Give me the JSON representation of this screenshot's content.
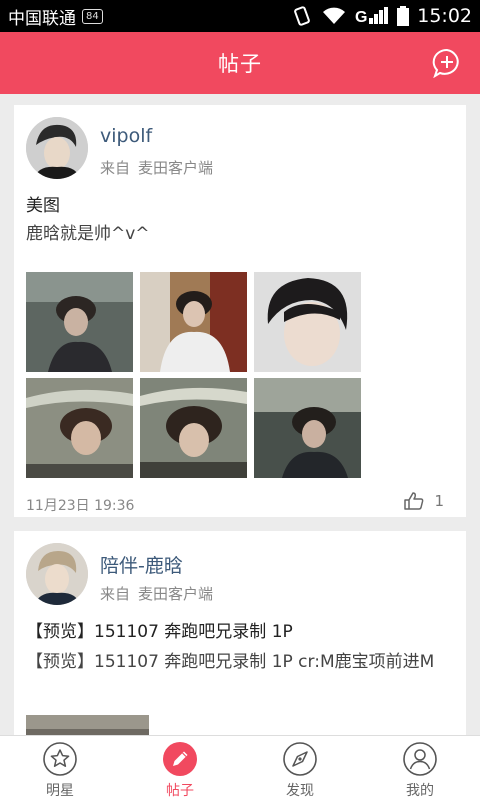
{
  "status_bar": {
    "carrier": "中国联通",
    "network_badge": "84",
    "time": "15:02"
  },
  "header": {
    "title": "帖子",
    "compose_icon": "add-comment-icon",
    "accent_color": "#f1495f"
  },
  "posts": [
    {
      "username": "vipolf",
      "source_prefix": "来自",
      "source_client": "麦田客户端",
      "title": "美图",
      "body": "鹿晗就是帅^v^",
      "image_count": 6,
      "time": "11月23日 19:36",
      "likes": "1"
    },
    {
      "username": "陪伴-鹿晗",
      "source_prefix": "来自",
      "source_client": "麦田客户端",
      "title": "【预览】151107 奔跑吧兄录制 1P",
      "body": "【预览】151107 奔跑吧兄录制 1P cr:M鹿宝项前进M"
    }
  ],
  "tabs": [
    {
      "label": "明星",
      "icon": "star-icon",
      "active": false
    },
    {
      "label": "帖子",
      "icon": "pencil-icon",
      "active": true
    },
    {
      "label": "发现",
      "icon": "compass-icon",
      "active": false
    },
    {
      "label": "我的",
      "icon": "person-icon",
      "active": false
    }
  ]
}
